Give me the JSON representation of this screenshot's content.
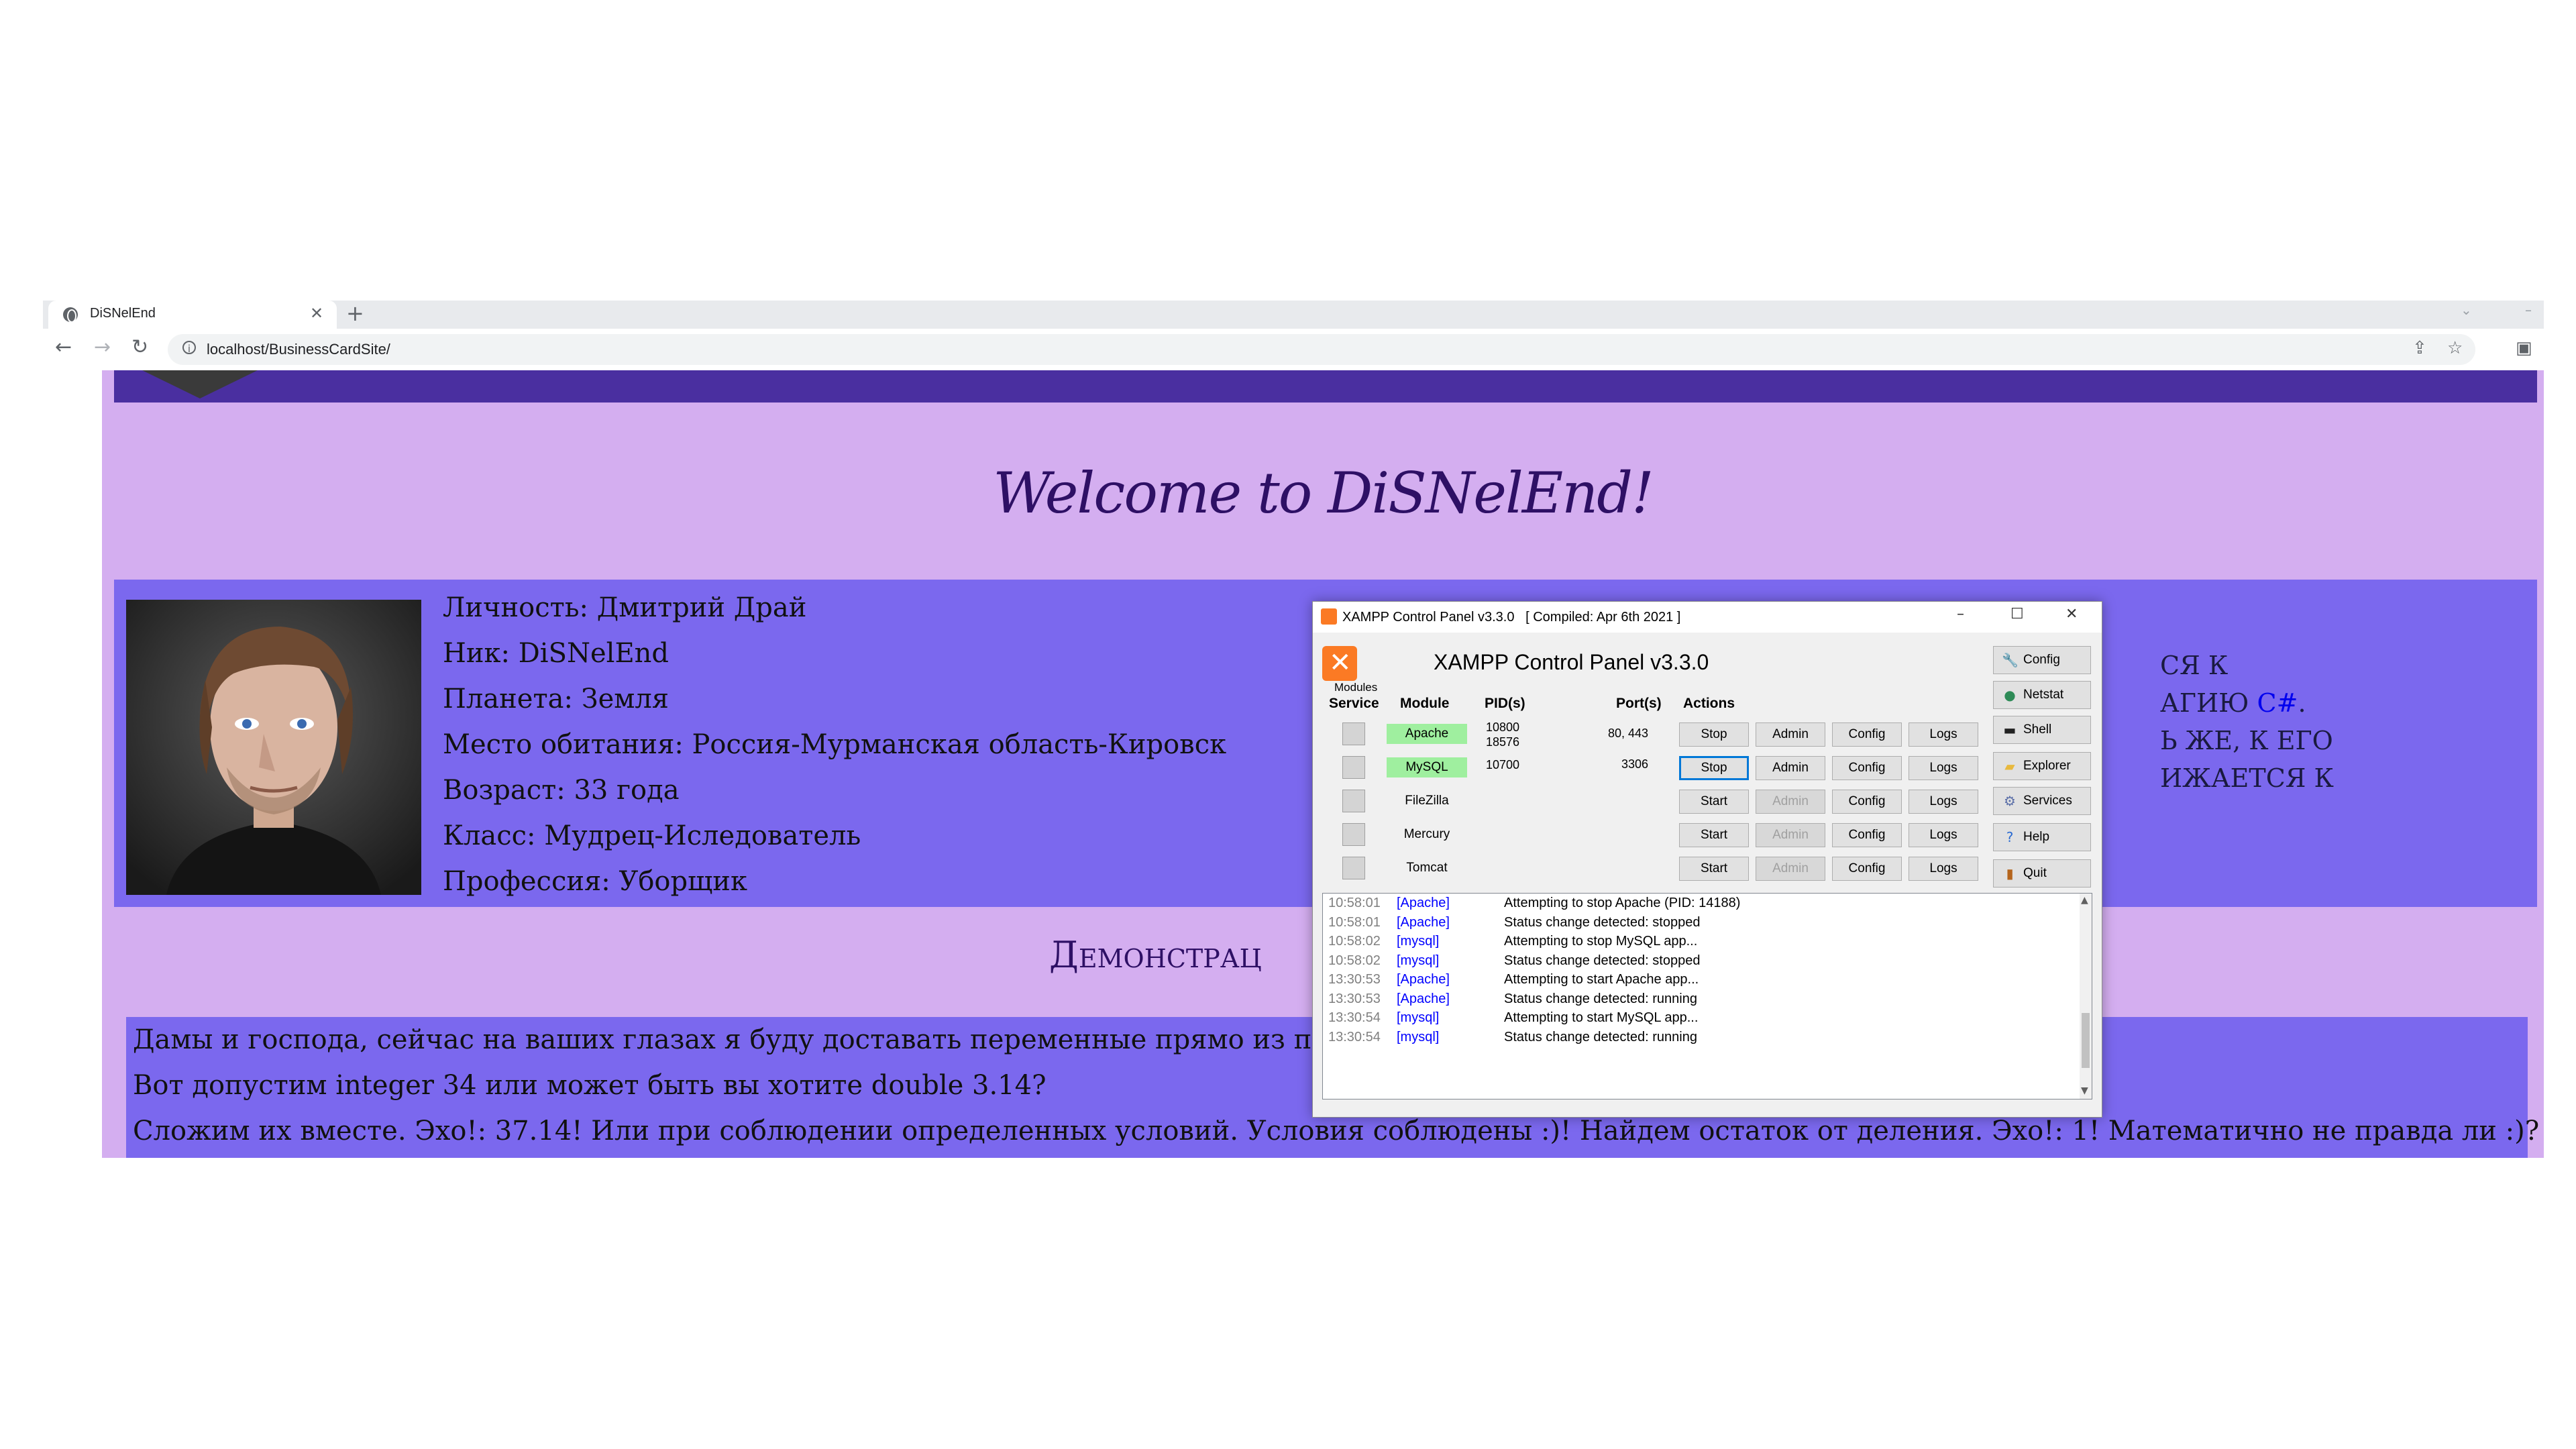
{
  "browser": {
    "tab_title": "DiSNelEnd",
    "url": "localhost/BusinessCardSite/"
  },
  "site": {
    "welcome": "Welcome to DiSNelEnd!",
    "profile_lines": [
      "Личность: Дмитрий Драй",
      "Ник: DiSNelEnd",
      "Планета: Земля",
      "Место обитания: Россия-Мурманская область-Кировск",
      "Возраст: 33 года",
      "Класс: Мудрец-Иследователь",
      "Профессия: Уборщик"
    ],
    "right_fragments": [
      "ся к",
      "агию",
      "C#",
      ".",
      "ь же, к его",
      "ижается к"
    ],
    "demo_heading": "Демонстрац",
    "demo_lines": [
      "Дамы и господа, сейчас на ваших глазах я буду доставать переменные прямо из подключе",
      "Вот допустим integer 34 или может быть вы хотите double 3.14?",
      "Сложим их вместе. Эхо!: 37.14! Или при соблюдении определенных условий. Условия соблюдены :)! Найдем остаток от деления. Эхо!: 1! Математично не правда ли :)?"
    ]
  },
  "xampp": {
    "window_title": "XAMPP Control Panel v3.3.0   [ Compiled: Apr 6th 2021 ]",
    "headline": "XAMPP Control Panel v3.3.0",
    "modules_caption": "Modules",
    "columns": {
      "service": "Service",
      "module": "Module",
      "pids": "PID(s)",
      "ports": "Port(s)",
      "actions": "Actions"
    },
    "rows": [
      {
        "module": "Apache",
        "pid1": "10800",
        "pid2": "18576",
        "ports": "80, 443",
        "action": "Stop",
        "admin": "Admin",
        "config": "Config",
        "logs": "Logs"
      },
      {
        "module": "MySQL",
        "pid1": "10700",
        "pid2": "",
        "ports": "3306",
        "action": "Stop",
        "admin": "Admin",
        "config": "Config",
        "logs": "Logs"
      },
      {
        "module": "FileZilla",
        "pid1": "",
        "pid2": "",
        "ports": "",
        "action": "Start",
        "admin": "Admin",
        "config": "Config",
        "logs": "Logs"
      },
      {
        "module": "Mercury",
        "pid1": "",
        "pid2": "",
        "ports": "",
        "action": "Start",
        "admin": "Admin",
        "config": "Config",
        "logs": "Logs"
      },
      {
        "module": "Tomcat",
        "pid1": "",
        "pid2": "",
        "ports": "",
        "action": "Start",
        "admin": "Admin",
        "config": "Config",
        "logs": "Logs"
      }
    ],
    "side_buttons": [
      {
        "label": "Config",
        "icon": "wrench-icon"
      },
      {
        "label": "Netstat",
        "icon": "globe-icon"
      },
      {
        "label": "Shell",
        "icon": "terminal-icon"
      },
      {
        "label": "Explorer",
        "icon": "folder-icon"
      },
      {
        "label": "Services",
        "icon": "services-icon"
      },
      {
        "label": "Help",
        "icon": "help-icon"
      },
      {
        "label": "Quit",
        "icon": "quit-icon"
      }
    ],
    "log": [
      {
        "time": "10:58:01",
        "module": "[Apache]",
        "msg": "Attempting to stop Apache (PID: 14188)"
      },
      {
        "time": "10:58:01",
        "module": "[Apache]",
        "msg": "Status change detected: stopped"
      },
      {
        "time": "10:58:02",
        "module": "[mysql]",
        "msg": "Attempting to stop MySQL app..."
      },
      {
        "time": "10:58:02",
        "module": "[mysql]",
        "msg": "Status change detected: stopped"
      },
      {
        "time": "13:30:53",
        "module": "[Apache]",
        "msg": "Attempting to start Apache app..."
      },
      {
        "time": "13:30:53",
        "module": "[Apache]",
        "msg": "Status change detected: running"
      },
      {
        "time": "13:30:54",
        "module": "[mysql]",
        "msg": "Attempting to start MySQL app..."
      },
      {
        "time": "13:30:54",
        "module": "[mysql]",
        "msg": "Status change detected: running"
      }
    ],
    "colors": {
      "running": "#9fef9f",
      "logo": "#fb7a24",
      "log_module": "#0000ff"
    }
  }
}
